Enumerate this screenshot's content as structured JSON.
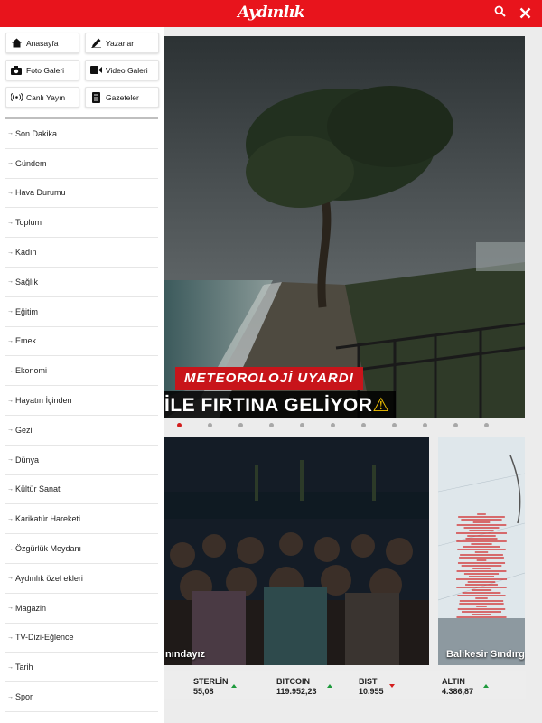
{
  "header": {
    "logo": "Aydınlık",
    "search_icon": "search-icon",
    "close_icon": "close-icon"
  },
  "quick_links": [
    {
      "label": "Anasayfa",
      "icon": "home-icon"
    },
    {
      "label": "Yazarlar",
      "icon": "pen-icon"
    },
    {
      "label": "Foto Galeri",
      "icon": "camera-icon"
    },
    {
      "label": "Video Galeri",
      "icon": "video-camera-icon"
    },
    {
      "label": "Canlı Yayın",
      "icon": "broadcast-icon"
    },
    {
      "label": "Gazeteler",
      "icon": "newspaper-icon"
    }
  ],
  "menu": [
    "Son Dakika",
    "Gündem",
    "Hava Durumu",
    "Toplum",
    "Kadın",
    "Sağlık",
    "Eğitim",
    "Emek",
    "Ekonomi",
    "Hayatın İçinden",
    "Gezi",
    "Dünya",
    "Kültür Sanat",
    "Karikatür Hareketi",
    "Özgürlük Meydanı",
    "Aydınlık özel ekleri",
    "Magazin",
    "TV-Dizi-Eğlence",
    "Tarih",
    "Spor"
  ],
  "hero": {
    "tag": "METEOROLOJİ UYARDI",
    "headline": "İLE FIRTINA GELİYOR",
    "warning_icon": "warning-icon"
  },
  "cards": [
    {
      "caption": "nındayız"
    },
    {
      "caption": "Balıkesir Sındırg"
    }
  ],
  "ticker": [
    {
      "name": "STERLİN",
      "value": "55,08",
      "trend": "up"
    },
    {
      "name": "BITCOIN",
      "value": "119.952,23",
      "trend": "up"
    },
    {
      "name": "BIST",
      "value": "10.955",
      "trend": "down"
    },
    {
      "name": "ALTIN",
      "value": "4.386,87",
      "trend": "up"
    }
  ],
  "colors": {
    "brand": "#e8141c",
    "up": "#1e9a3c",
    "down": "#d41d1d"
  }
}
